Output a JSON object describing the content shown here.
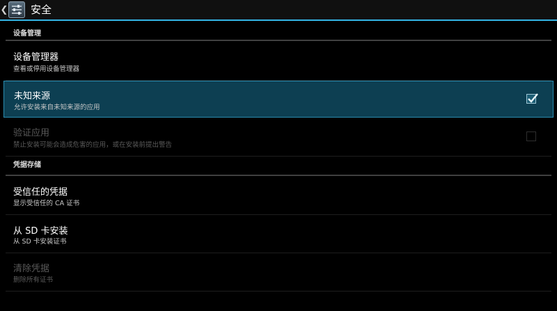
{
  "actionbar": {
    "title": "安全",
    "up_icon": "chevron-left-icon",
    "app_icon": "settings-icon"
  },
  "sections": {
    "device_admin": {
      "header": "设备管理",
      "device_managers": {
        "title": "设备管理器",
        "summary": "查看或停用设备管理器"
      },
      "unknown_sources": {
        "title": "未知来源",
        "summary": "允许安装来自未知来源的应用",
        "checked": true
      },
      "verify_apps": {
        "title": "验证应用",
        "summary": "禁止安装可能会造成危害的应用，或在安装前提出警告",
        "checked": false,
        "enabled": false
      }
    },
    "credential_storage": {
      "header": "凭据存储",
      "trusted_credentials": {
        "title": "受信任的凭据",
        "summary": "显示受信任的 CA 证书"
      },
      "install_from_sd": {
        "title": "从 SD 卡安装",
        "summary": "从 SD 卡安装证书"
      },
      "clear_credentials": {
        "title": "清除凭据",
        "summary": "删除所有证书",
        "enabled": false
      }
    }
  },
  "colors": {
    "accent": "#33b5e5",
    "selected_bg": "#0d3f52",
    "background": "#000000"
  }
}
